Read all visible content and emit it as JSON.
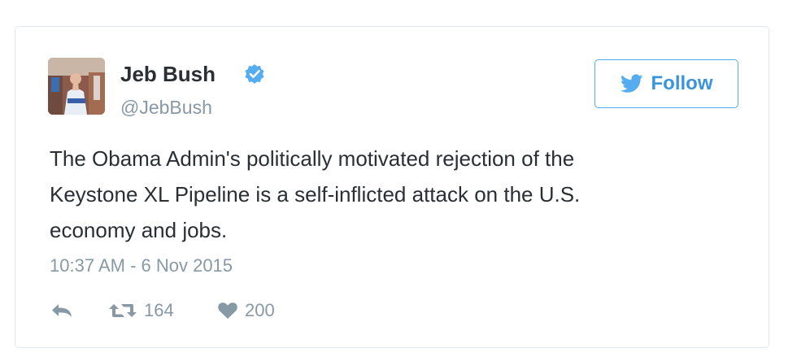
{
  "tweet": {
    "author": {
      "name": "Jeb Bush",
      "handle": "@JebBush",
      "verified": true
    },
    "follow_label": "Follow",
    "text_lines": [
      "The Obama Admin's politically motivated rejection of the",
      "Keystone XL Pipeline is a self-inflicted attack on the U.S.",
      "economy and jobs."
    ],
    "timestamp": "10:37 AM - 6 Nov 2015",
    "retweets": "164",
    "likes": "200"
  },
  "colors": {
    "brand_blue": "#55acee",
    "follow_text": "#3b94d9",
    "text": "#292f33",
    "muted": "#8899a6",
    "border": "#e1e8ed"
  },
  "icons": {
    "verified": "verified-badge-icon",
    "follow": "twitter-bird-icon",
    "reply": "reply-icon",
    "retweet": "retweet-icon",
    "like": "heart-icon"
  }
}
